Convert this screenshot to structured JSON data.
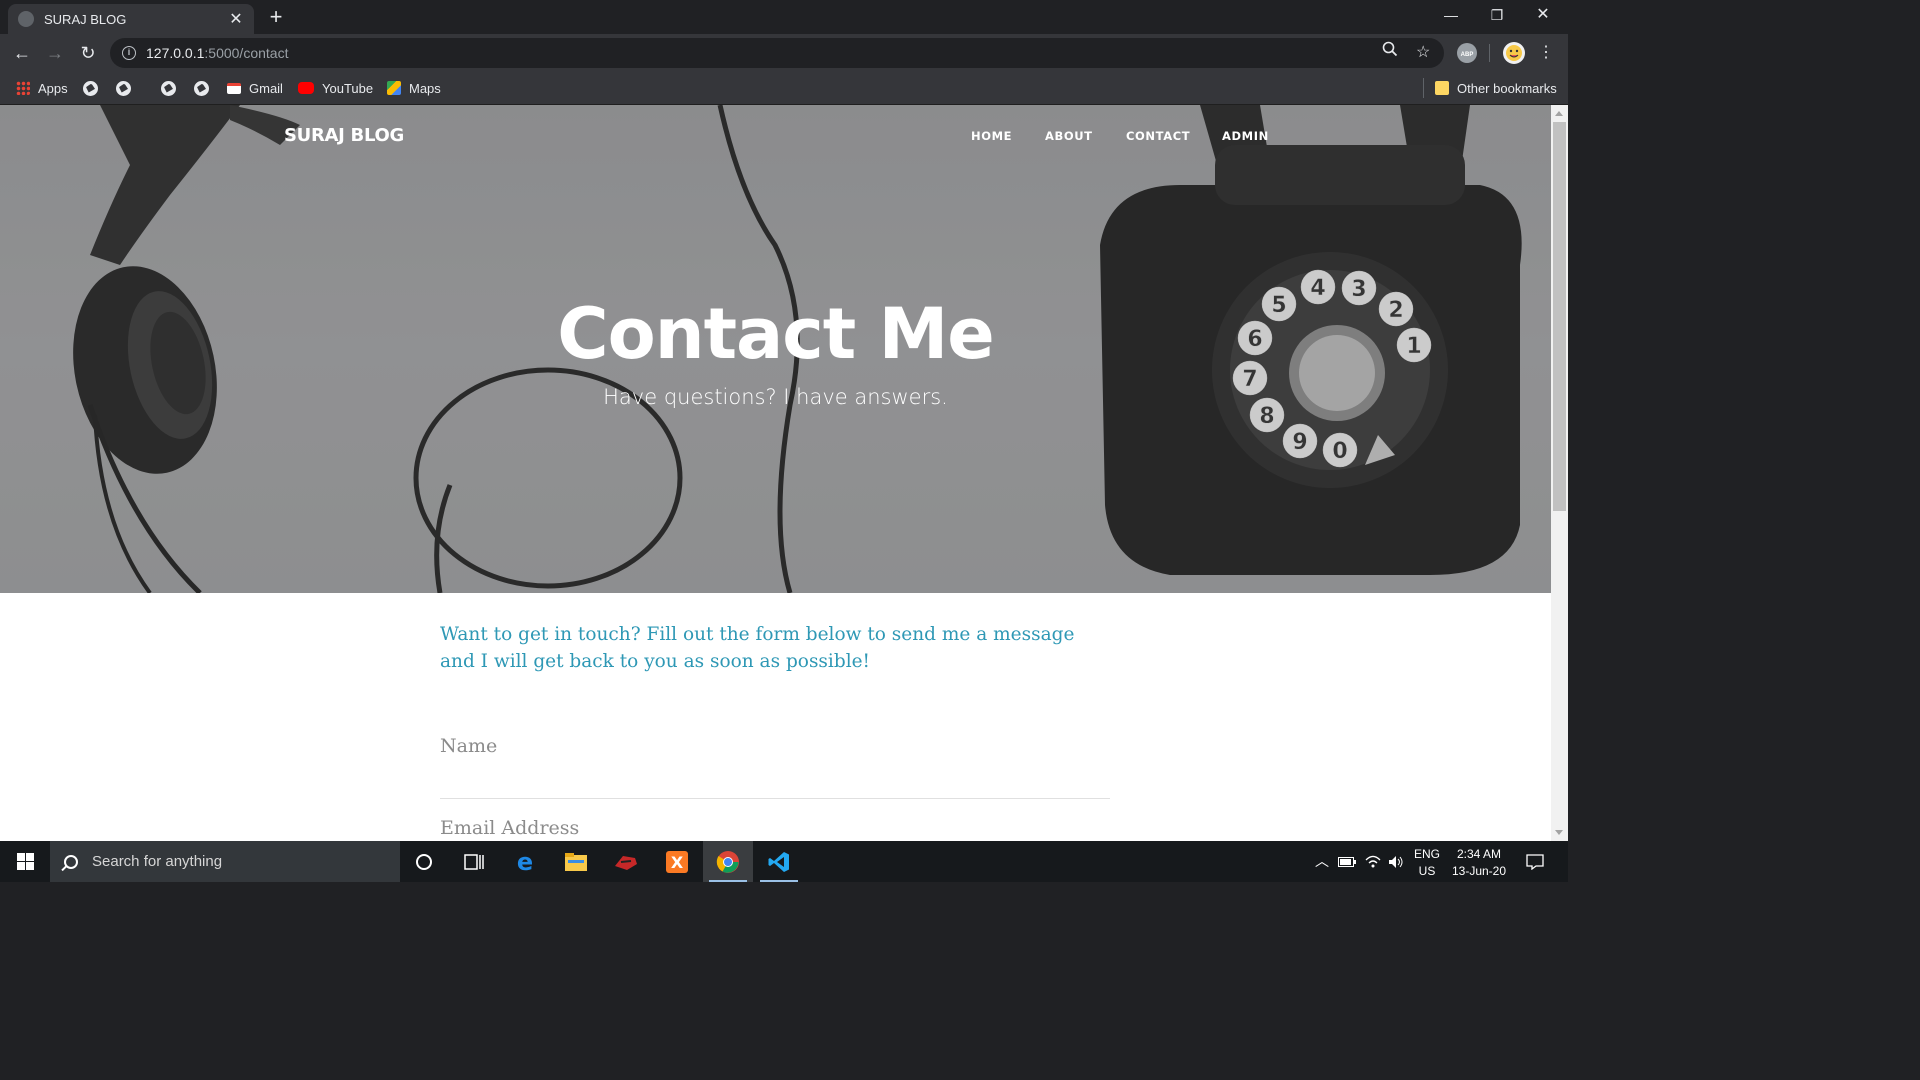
{
  "browser": {
    "tab_title": "SURAJ BLOG",
    "tab_close": "✕",
    "new_tab": "+",
    "url_host": "127.0.0.1",
    "url_path": ":5000/contact",
    "bookmarks": {
      "apps": "Apps",
      "gmail": "Gmail",
      "youtube": "YouTube",
      "maps": "Maps",
      "other": "Other bookmarks"
    }
  },
  "site": {
    "brand": "SURAJ BLOG",
    "nav": [
      "HOME",
      "ABOUT",
      "CONTACT",
      "ADMIN"
    ],
    "hero_title": "Contact Me",
    "hero_subtitle": "Have questions? I have answers.",
    "intro": "Want to get in touch? Fill out the form below to send me a message and I will get back to you as soon as possible!",
    "form": {
      "name_placeholder": "Name",
      "email_placeholder": "Email Address"
    }
  },
  "taskbar": {
    "search_placeholder": "Search for anything",
    "lang_top": "ENG",
    "lang_bottom": "US",
    "time": "2:34 AM",
    "date": "13-Jun-20"
  },
  "colors": {
    "accent": "#2e98b5",
    "chrome_dark": "#202124",
    "chrome_toolbar": "#35363a"
  }
}
